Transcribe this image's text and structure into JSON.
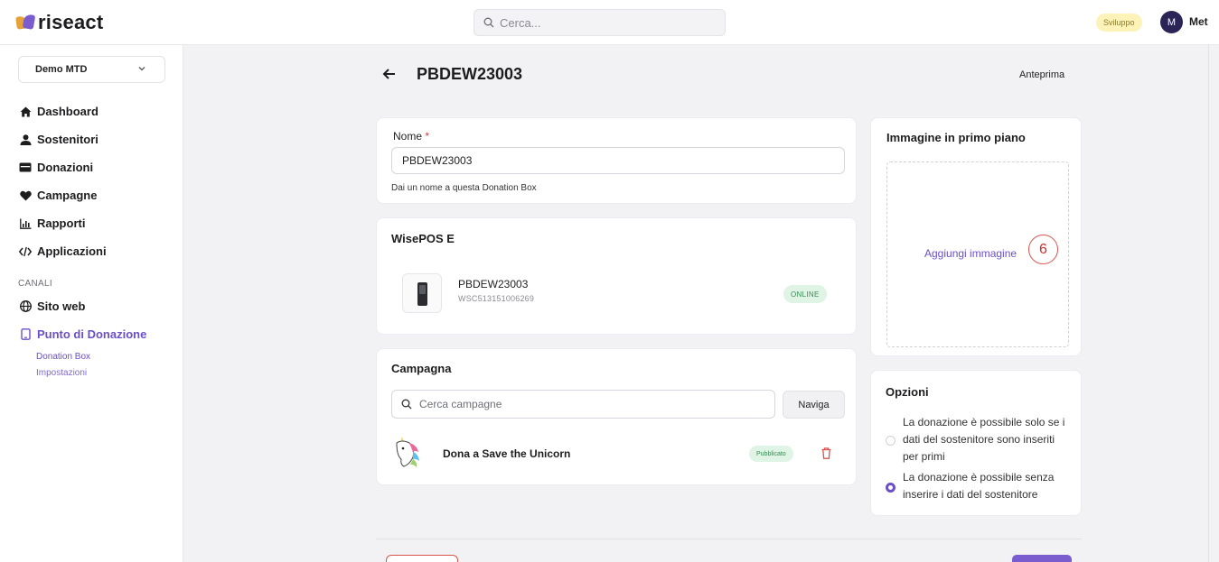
{
  "app": {
    "logo_text": "riseact",
    "search_placeholder": "Cerca...",
    "env_badge": "Sviluppo",
    "avatar_initial": "M",
    "user_name": "Met"
  },
  "sidebar": {
    "org_select": "Demo MTD",
    "items": [
      {
        "label": "Dashboard",
        "icon": "home-icon"
      },
      {
        "label": "Sostenitori",
        "icon": "user-icon"
      },
      {
        "label": "Donazioni",
        "icon": "wallet-icon"
      },
      {
        "label": "Campagne",
        "icon": "heart-icon"
      },
      {
        "label": "Rapporti",
        "icon": "chart-icon"
      },
      {
        "label": "Applicazioni",
        "icon": "code-icon"
      }
    ],
    "section_label": "CANALI",
    "channels": [
      {
        "label": "Sito web",
        "icon": "globe-icon"
      },
      {
        "label": "Punto di Donazione",
        "icon": "device-icon"
      }
    ],
    "sub_items": [
      "Donation Box",
      "Impostazioni"
    ]
  },
  "header": {
    "title": "PBDEW23003",
    "preview": "Anteprima"
  },
  "nome_card": {
    "label": "Nome",
    "required_mark": "*",
    "value": "PBDEW23003",
    "help": "Dai un nome a questa Donation Box"
  },
  "pos_card": {
    "title": "WisePOS E",
    "device_name": "PBDEW23003",
    "device_serial": "WSC513151006269",
    "status": "ONLINE"
  },
  "campaign_card": {
    "title": "Campagna",
    "search_placeholder": "Cerca campagne",
    "navigate_label": "Naviga",
    "campaign_name": "Dona a Save the Unicorn",
    "campaign_status": "Pubblicato"
  },
  "image_card": {
    "title": "Immagine in primo piano",
    "add_label": "Aggiungi immagine",
    "step_number": "6"
  },
  "options_card": {
    "title": "Opzioni",
    "options": [
      {
        "label": "La donazione è possibile solo se i dati del sostenitore sono inseriti per primi",
        "checked": false
      },
      {
        "label": "La donazione è possibile senza inserire i dati del sostenitore",
        "checked": true
      }
    ]
  },
  "colors": {
    "accent": "#6b4fc7",
    "danger": "#d9534f",
    "success_bg": "#dff4e5"
  }
}
